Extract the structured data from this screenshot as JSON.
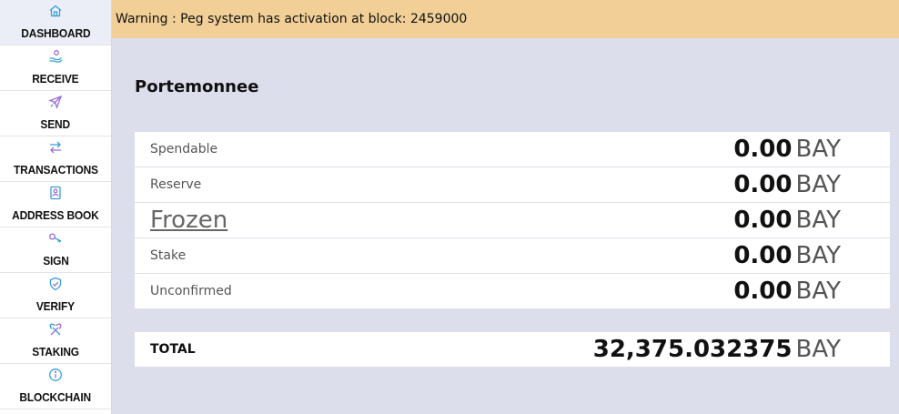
{
  "sidebar": {
    "items": [
      {
        "label": "DASHBOARD",
        "icon": "home-icon",
        "active": true
      },
      {
        "label": "RECEIVE",
        "icon": "receive-hand-icon",
        "active": false
      },
      {
        "label": "SEND",
        "icon": "rocket-icon",
        "active": false
      },
      {
        "label": "TRANSACTIONS",
        "icon": "swap-arrows-icon",
        "active": false
      },
      {
        "label": "ADDRESS BOOK",
        "icon": "address-book-icon",
        "active": false
      },
      {
        "label": "SIGN",
        "icon": "key-icon",
        "active": false
      },
      {
        "label": "VERIFY",
        "icon": "shield-check-icon",
        "active": false
      },
      {
        "label": "STAKING",
        "icon": "hammer-pick-icon",
        "active": false
      },
      {
        "label": "BLOCKCHAIN",
        "icon": "info-icon",
        "active": false
      }
    ]
  },
  "warning": {
    "text": "Warning : Peg system has activation at block: 2459000"
  },
  "main": {
    "title": "Portemonnee",
    "balances": [
      {
        "label": "Spendable",
        "amount": "0.00",
        "unit": "BAY"
      },
      {
        "label": "Reserve",
        "amount": "0.00",
        "unit": "BAY"
      },
      {
        "label": "Frozen",
        "amount": "0.00",
        "unit": "BAY"
      },
      {
        "label": "Stake",
        "amount": "0.00",
        "unit": "BAY"
      },
      {
        "label": "Unconfirmed",
        "amount": "0.00",
        "unit": "BAY"
      }
    ],
    "total": {
      "label": "TOTAL",
      "amount": "32,375.032375",
      "unit": "BAY"
    }
  },
  "colors": {
    "accent": "#3aa0d8",
    "warning_bg": "#f1cf97",
    "content_bg": "#dcdeec"
  }
}
